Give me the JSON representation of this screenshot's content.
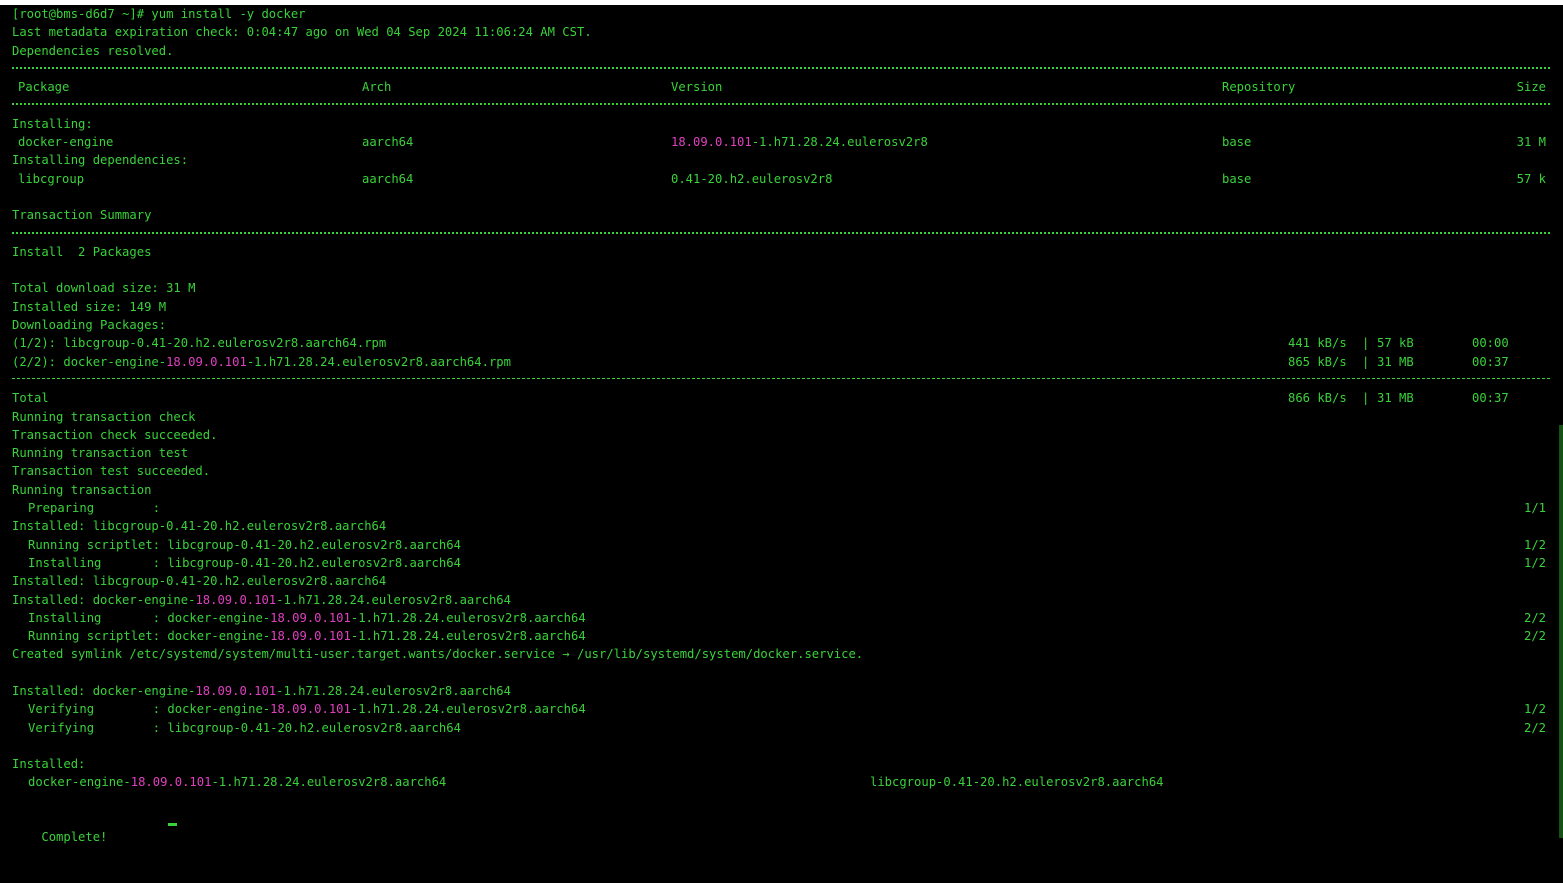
{
  "terminal": {
    "prompt_line": "[root@bms-d6d7 ~]# yum install -y docker",
    "meta_line": "Last metadata expiration check: 0:04:47 ago on Wed 04 Sep 2024 11:06:24 AM CST.",
    "deps_resolved": "Dependencies resolved.",
    "table": {
      "headers": {
        "package": "Package",
        "arch": "Arch",
        "version": "Version",
        "repository": "Repository",
        "size": "Size"
      },
      "installing_label": "Installing:",
      "deps_label": "Installing dependencies:",
      "rows": [
        {
          "package": "docker-engine",
          "arch": "aarch64",
          "version_hl": "18.09.0.101",
          "version_rest": "-1.h71.28.24.eulerosv2r8",
          "repository": "base",
          "size": "31 M"
        },
        {
          "package": "libcgroup",
          "arch": "aarch64",
          "version_hl": "",
          "version_rest": "0.41-20.h2.eulerosv2r8",
          "repository": "base",
          "size": "57 k"
        }
      ]
    },
    "transaction_summary": "Transaction Summary",
    "install_count": "Install  2 Packages",
    "total_download": "Total download size: 31 M",
    "installed_size": "Installed size: 149 M",
    "downloading": "Downloading Packages:",
    "downloads": [
      {
        "pre": "(1/2): libcgroup-0.41-20.h2.eulerosv2r8.aarch64.rpm",
        "hl": "",
        "post": "",
        "speed": "441 kB/s",
        "size": "57 kB",
        "time": "00:00"
      },
      {
        "pre": "(2/2): docker-engine-",
        "hl": "18.09.0.101",
        "post": "-1.h71.28.24.eulerosv2r8.aarch64.rpm",
        "speed": "865 kB/s",
        "size": "31 MB",
        "time": "00:37"
      }
    ],
    "total": {
      "label": "Total",
      "speed": "866 kB/s",
      "size": "31 MB",
      "time": "00:37"
    },
    "steps": [
      "Running transaction check",
      "Transaction check succeeded.",
      "Running transaction test",
      "Transaction test succeeded.",
      "Running transaction"
    ],
    "progress": [
      {
        "indent": true,
        "pre": "Preparing        :",
        "hl": "",
        "post": "",
        "count": "1/1"
      },
      {
        "indent": false,
        "pre": "Installed: libcgroup-0.41-20.h2.eulerosv2r8.aarch64",
        "hl": "",
        "post": "",
        "count": ""
      },
      {
        "indent": true,
        "pre": "Running scriptlet: libcgroup-0.41-20.h2.eulerosv2r8.aarch64",
        "hl": "",
        "post": "",
        "count": "1/2"
      },
      {
        "indent": true,
        "pre": "Installing       : libcgroup-0.41-20.h2.eulerosv2r8.aarch64",
        "hl": "",
        "post": "",
        "count": "1/2"
      },
      {
        "indent": false,
        "pre": "Installed: libcgroup-0.41-20.h2.eulerosv2r8.aarch64",
        "hl": "",
        "post": "",
        "count": ""
      },
      {
        "indent": false,
        "pre": "Installed: docker-engine-",
        "hl": "18.09.0.101",
        "post": "-1.h71.28.24.eulerosv2r8.aarch64",
        "count": ""
      },
      {
        "indent": true,
        "pre": "Installing       : docker-engine-",
        "hl": "18.09.0.101",
        "post": "-1.h71.28.24.eulerosv2r8.aarch64",
        "count": "2/2"
      },
      {
        "indent": true,
        "pre": "Running scriptlet: docker-engine-",
        "hl": "18.09.0.101",
        "post": "-1.h71.28.24.eulerosv2r8.aarch64",
        "count": "2/2"
      },
      {
        "indent": false,
        "pre": "Created symlink /etc/systemd/system/multi-user.target.wants/docker.service → /usr/lib/systemd/system/docker.service.",
        "hl": "",
        "post": "",
        "count": ""
      }
    ],
    "verify": [
      {
        "indent": false,
        "pre": "Installed: docker-engine-",
        "hl": "18.09.0.101",
        "post": "-1.h71.28.24.eulerosv2r8.aarch64",
        "count": ""
      },
      {
        "indent": true,
        "pre": "Verifying        : docker-engine-",
        "hl": "18.09.0.101",
        "post": "-1.h71.28.24.eulerosv2r8.aarch64",
        "count": "1/2"
      },
      {
        "indent": true,
        "pre": "Verifying        : libcgroup-0.41-20.h2.eulerosv2r8.aarch64",
        "hl": "",
        "post": "",
        "count": "2/2"
      }
    ],
    "installed_label": "Installed:",
    "installed_pkgs": {
      "a_pre": "docker-engine-",
      "a_hl": "18.09.0.101",
      "a_post": "-1.h71.28.24.eulerosv2r8.aarch64",
      "b": "libcgroup-0.41-20.h2.eulerosv2r8.aarch64"
    },
    "complete": "Complete!",
    "colors": {
      "text": "#3ad23a",
      "highlight": "#e040c0",
      "background": "#000000"
    }
  }
}
